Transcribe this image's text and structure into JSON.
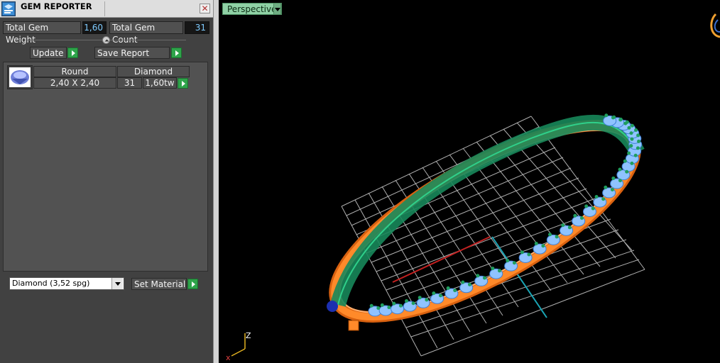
{
  "panel": {
    "title": "GEM REPORTER",
    "close_glyph": "✕",
    "total_weight_label": "Total Gem Weight",
    "total_weight_value": "1,60",
    "total_count_label": "Total Gem Count",
    "total_count_value": "31",
    "update_label": "Update",
    "save_report_label": "Save Report",
    "gem_row": {
      "shape": "Round",
      "type": "Diamond",
      "size": "2,40 X 2,40",
      "count": "31",
      "weight": "1,60tw"
    },
    "material_select": "Diamond      (3,52 spg)",
    "set_material_label": "Set Material"
  },
  "viewport": {
    "view_label": "Perspective",
    "axis_z": "Z",
    "axis_x": "x"
  },
  "colors": {
    "bg_panel": "#414141",
    "value_text": "#7ecbff",
    "go_green": "#2ea44a",
    "ring_orange": "#ff7a1a",
    "prong_green": "#1f9e5e",
    "gem_blue": "#8fc3ff",
    "grid": "#d8d8d8"
  },
  "icons": {
    "title_icon": "gem-reporter-icon",
    "close": "close-icon",
    "arrow": "play-arrow-icon",
    "gem_thumb": "round-gem-icon",
    "collapse": "collapse-arrow-icon",
    "dropdown": "chevron-down-icon"
  }
}
